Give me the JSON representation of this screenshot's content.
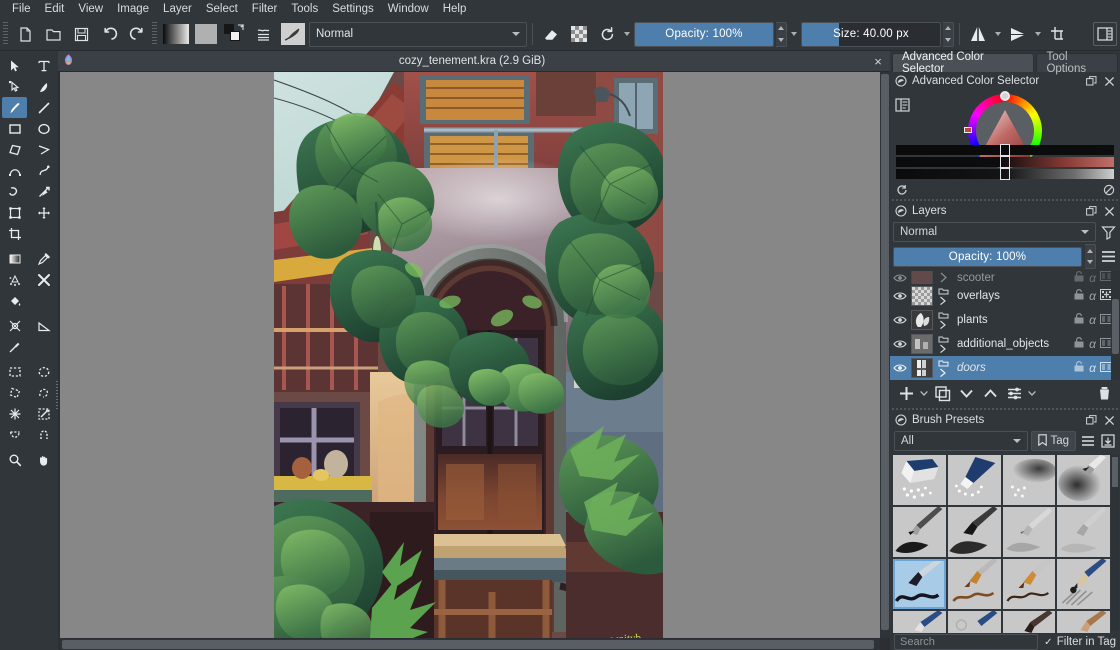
{
  "menu": {
    "items": [
      {
        "label": "File"
      },
      {
        "label": "Edit"
      },
      {
        "label": "View"
      },
      {
        "label": "Image"
      },
      {
        "label": "Layer"
      },
      {
        "label": "Select"
      },
      {
        "label": "Filter"
      },
      {
        "label": "Tools"
      },
      {
        "label": "Settings"
      },
      {
        "label": "Window"
      },
      {
        "label": "Help"
      }
    ]
  },
  "toolbar": {
    "new_icon": "new-document-icon",
    "open_icon": "open-document-icon",
    "save_icon": "save-icon",
    "undo_icon": "undo-icon",
    "redo_icon": "redo-icon",
    "gradient_icon": "gradient-preview-icon",
    "pattern_icon": "pattern-preview-icon",
    "fgbg_icon": "foreground-background-color-icon",
    "workspace_icon": "workspace-chooser-icon",
    "brush_preset_icon": "brush-preset-icon",
    "blend_mode": "Normal",
    "eraser_icon": "eraser-toggle-icon",
    "alpha_icon": "preserve-alpha-icon",
    "reload_icon": "reload-preset-icon",
    "opacity_label": "Opacity: 100%",
    "opacity_value": 100,
    "size_label": "Size: 40.00 px",
    "size_value": 40,
    "mirror_h_icon": "mirror-horizontal-icon",
    "mirror_v_icon": "mirror-vertical-icon",
    "wrap_icon": "wrap-around-mode-icon",
    "show_dockers_icon": "show-dockers-icon"
  },
  "toolbox": {
    "tools": [
      {
        "name": "shape-select-tool",
        "icon": "cursor-arrow-icon",
        "active": false
      },
      {
        "name": "text-tool",
        "icon": "text-icon",
        "active": false
      },
      {
        "name": "edit-shapes-tool",
        "icon": "edit-shapes-icon",
        "active": false
      },
      {
        "name": "calligraphy-tool",
        "icon": "calligraphy-icon",
        "active": false
      },
      {
        "name": "freehand-brush-tool",
        "icon": "paintbrush-icon",
        "active": true
      },
      {
        "name": "line-tool",
        "icon": "line-icon",
        "active": false
      },
      {
        "name": "rectangle-tool",
        "icon": "rectangle-icon",
        "active": false
      },
      {
        "name": "ellipse-tool",
        "icon": "ellipse-icon",
        "active": false
      },
      {
        "name": "polygon-tool",
        "icon": "polygon-icon",
        "active": false
      },
      {
        "name": "polyline-tool",
        "icon": "polyline-icon",
        "active": false
      },
      {
        "name": "bezier-curve-tool",
        "icon": "bezier-curve-icon",
        "active": false
      },
      {
        "name": "freehand-path-tool",
        "icon": "freehand-path-icon",
        "active": false
      },
      {
        "name": "dynamic-brush-tool",
        "icon": "dynamic-brush-icon",
        "active": false
      },
      {
        "name": "multibrush-tool",
        "icon": "multibrush-icon",
        "active": false
      },
      {
        "name": "transform-tool",
        "icon": "transform-icon",
        "active": false
      },
      {
        "name": "move-tool",
        "icon": "move-icon",
        "active": false
      },
      {
        "name": "crop-tool",
        "icon": "crop-icon",
        "active": false
      },
      {
        "name": "gradient-tool",
        "icon": "gradient-icon",
        "active": false
      },
      {
        "name": "color-picker-tool",
        "icon": "eyedropper-icon",
        "active": false
      },
      {
        "name": "colorize-mask-tool",
        "icon": "colorize-mask-icon",
        "active": false
      },
      {
        "name": "smart-patch-tool",
        "icon": "smart-patch-icon",
        "active": false
      },
      {
        "name": "fill-tool",
        "icon": "fill-bucket-icon",
        "active": false
      },
      {
        "name": "enclose-and-fill-tool",
        "icon": "enclose-fill-icon",
        "active": false
      },
      {
        "name": "measure-tool",
        "icon": "measure-icon",
        "active": false
      },
      {
        "name": "assistant-tool",
        "icon": "assistant-pin-icon",
        "active": false
      },
      {
        "name": "rectangular-selection-tool",
        "icon": "select-rectangle-icon",
        "active": false
      },
      {
        "name": "elliptical-selection-tool",
        "icon": "select-ellipse-icon",
        "active": false
      },
      {
        "name": "polygonal-selection-tool",
        "icon": "select-polygon-icon",
        "active": false
      },
      {
        "name": "freehand-selection-tool",
        "icon": "select-freehand-icon",
        "active": false
      },
      {
        "name": "contiguous-selection-tool",
        "icon": "select-magic-wand-icon",
        "active": false
      },
      {
        "name": "similar-color-selection-tool",
        "icon": "select-similar-icon",
        "active": false
      },
      {
        "name": "bezier-selection-tool",
        "icon": "select-bezier-icon",
        "active": false
      },
      {
        "name": "magnetic-selection-tool",
        "icon": "select-magnetic-icon",
        "active": false
      },
      {
        "name": "zoom-tool",
        "icon": "magnifier-icon",
        "active": false
      },
      {
        "name": "pan-tool",
        "icon": "hand-icon",
        "active": false
      }
    ]
  },
  "document": {
    "tab_title": "cozy_tenement.kra (2.9 GiB)",
    "close_label": "×",
    "app_icon": "krita-logo-icon",
    "artwork_description": "Digital painting of an arched doorway of a cozy tenement building overgrown with green foliage",
    "artwork_signature": "wojtyb"
  },
  "dock": {
    "tabs": [
      {
        "label": "Advanced Color Selector",
        "selected": true
      },
      {
        "label": "Tool Options",
        "selected": false
      }
    ],
    "color_selector": {
      "title": "Advanced Color Selector",
      "header_icon": "color-selector-icon",
      "float_icon": "float-docker-icon",
      "close_icon": "close-icon",
      "settings_icon": "docker-settings-icon",
      "reset_icon": "reset-color-icon",
      "nocolor_icon": "no-color-icon"
    },
    "layers": {
      "title": "Layers",
      "header_icon": "layers-icon",
      "float_icon": "float-docker-icon",
      "close_icon": "close-icon",
      "blend_mode": "Normal",
      "filter_icon": "filter-layers-icon",
      "menu_icon": "layer-properties-menu-icon",
      "opacity_label": "Opacity:  100%",
      "opacity_value": 100,
      "rows": [
        {
          "name": "scooter",
          "visible": true,
          "selected": false,
          "partial": true,
          "thumb": "paint-layer-thumb",
          "kind": "group"
        },
        {
          "name": "overlays",
          "visible": true,
          "selected": false,
          "partial": false,
          "thumb": "transparent-thumb",
          "kind": "group"
        },
        {
          "name": "plants",
          "visible": true,
          "selected": false,
          "partial": false,
          "thumb": "paint-layer-thumb",
          "kind": "group"
        },
        {
          "name": "additional_objects",
          "visible": true,
          "selected": false,
          "partial": false,
          "thumb": "paint-layer-thumb",
          "kind": "group"
        },
        {
          "name": "doors",
          "visible": true,
          "selected": true,
          "partial": false,
          "thumb": "paint-layer-thumb",
          "kind": "group"
        }
      ],
      "row_prop_icons": [
        "lock-icon",
        "alpha-inherit-icon",
        "onion-skin-icon"
      ],
      "toolbar": [
        {
          "name": "add-layer-button",
          "icon": "plus-icon"
        },
        {
          "name": "add-layer-dropdown",
          "icon": "chevron-down-icon"
        },
        {
          "name": "duplicate-layer-button",
          "icon": "duplicate-icon"
        },
        {
          "name": "move-layer-down-button",
          "icon": "chevron-down-icon"
        },
        {
          "name": "move-layer-up-button",
          "icon": "chevron-up-icon"
        },
        {
          "name": "layer-properties-button",
          "icon": "sliders-icon"
        },
        {
          "name": "layer-properties-dropdown",
          "icon": "chevron-down-icon"
        },
        {
          "name": "delete-layer-button",
          "icon": "trash-icon"
        }
      ]
    },
    "brush_presets": {
      "title": "Brush Presets",
      "header_icon": "brush-presets-icon",
      "float_icon": "float-docker-icon",
      "close_icon": "close-icon",
      "tag_filter": "All",
      "tag_button": "Tag",
      "tag_icon": "tag-icon",
      "list_icon": "list-view-icon",
      "store_icon": "save-tag-icon",
      "search_placeholder": "Search",
      "filter_in_tag_label": "Filter in Tag",
      "filter_in_tag_checked": true,
      "presets": [
        {
          "name": "eraser-soft",
          "selected": false,
          "kind": "eraser-block"
        },
        {
          "name": "eraser-small",
          "selected": false,
          "kind": "eraser-block"
        },
        {
          "name": "eraser-airbrush",
          "selected": false,
          "kind": "soft-smudge"
        },
        {
          "name": "airbrush-soft",
          "selected": false,
          "kind": "airbrush"
        },
        {
          "name": "ink-pen-dark",
          "selected": false,
          "kind": "pen-dark"
        },
        {
          "name": "ink-brush-dark",
          "selected": false,
          "kind": "pen-dark"
        },
        {
          "name": "pencil-light",
          "selected": false,
          "kind": "pencil-light"
        },
        {
          "name": "pencil-soft",
          "selected": false,
          "kind": "pencil-light"
        },
        {
          "name": "paint-basic",
          "selected": true,
          "kind": "paint-brush"
        },
        {
          "name": "bristle-brush",
          "selected": false,
          "kind": "bristle"
        },
        {
          "name": "wet-brush",
          "selected": false,
          "kind": "wet"
        },
        {
          "name": "pencil-2b",
          "selected": false,
          "kind": "pencil-graphite"
        },
        {
          "name": "blue-pen-row4",
          "selected": false,
          "kind": "pen-blue"
        },
        {
          "name": "blue-marker-row4",
          "selected": false,
          "kind": "pen-blue"
        },
        {
          "name": "dark-brush-row4",
          "selected": false,
          "kind": "dark-brush"
        },
        {
          "name": "tan-brush-row4",
          "selected": false,
          "kind": "tan-brush"
        }
      ]
    }
  },
  "colors": {
    "window_bg": "#31363b",
    "accent_blue": "#4e7eab",
    "canvas_bg": "#878787",
    "text": "#d3d7d9",
    "panel_alt": "#3a4045"
  }
}
